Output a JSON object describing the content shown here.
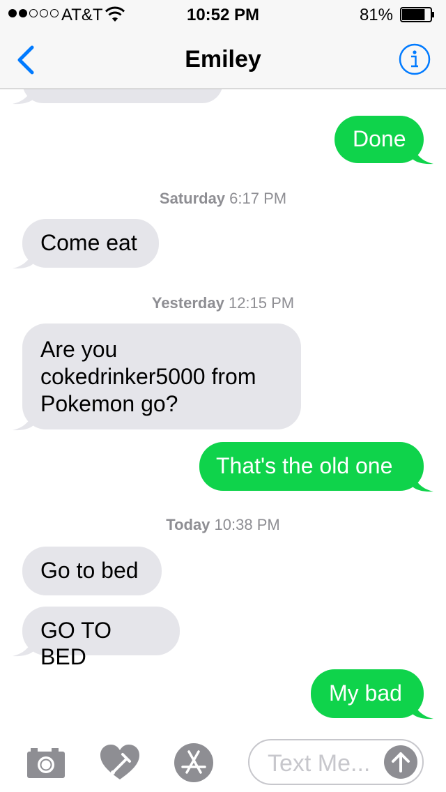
{
  "status_bar": {
    "carrier": "AT&T",
    "time": "10:52 PM",
    "battery": "81%",
    "signal_bars": 2,
    "battery_level": 0.81
  },
  "nav": {
    "title": "Emiley"
  },
  "timestamps": [
    {
      "day": "Saturday",
      "time": "6:17 PM"
    },
    {
      "day": "Yesterday",
      "time": "12:15 PM"
    },
    {
      "day": "Today",
      "time": "10:38 PM"
    }
  ],
  "messages": [
    {
      "direction": "out",
      "text": "Done"
    },
    {
      "direction": "in",
      "text": "Come eat"
    },
    {
      "direction": "in",
      "text": "Are you\ncokedrinker5000 from\nPokemon go?"
    },
    {
      "direction": "out",
      "text": "That's the old one"
    },
    {
      "direction": "in",
      "text": "Go to bed"
    },
    {
      "direction": "in",
      "text": "GO TO BED"
    },
    {
      "direction": "out",
      "text": "My bad"
    }
  ],
  "input": {
    "placeholder": "Text Me..."
  },
  "colors": {
    "accent": "#007aff",
    "outgoing_bubble": "#0fd34b",
    "incoming_bubble": "#e5e5ea",
    "timestamp": "#8e8e93"
  },
  "icons": [
    "back-chevron-icon",
    "info-icon",
    "camera-icon",
    "digital-touch-heart-icon",
    "app-store-icon",
    "send-arrow-icon"
  ]
}
